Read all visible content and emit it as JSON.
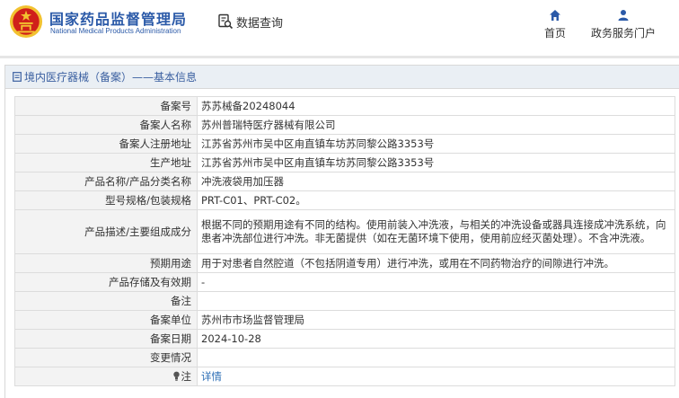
{
  "header": {
    "org_name_cn": "国家药品监督管理局",
    "org_name_en": "National Medical Products Administration",
    "query_label": "数据查询",
    "nav": [
      {
        "label": "首页",
        "icon": "home-icon"
      },
      {
        "label": "政务服务门户",
        "icon": "user-icon"
      }
    ]
  },
  "panel": {
    "title": "境内医疗器械（备案）——基本信息"
  },
  "rows": [
    {
      "label": "备案号",
      "value": "苏苏械备20248044"
    },
    {
      "label": "备案人名称",
      "value": "苏州普瑞特医疗器械有限公司"
    },
    {
      "label": "备案人注册地址",
      "value": "江苏省苏州市吴中区甪直镇车坊苏同黎公路3353号"
    },
    {
      "label": "生产地址",
      "value": "江苏省苏州市吴中区甪直镇车坊苏同黎公路3353号"
    },
    {
      "label": "产品名称/产品分类名称",
      "value": "冲洗液袋用加压器"
    },
    {
      "label": "型号规格/包装规格",
      "value": "PRT-C01、PRT-C02。"
    },
    {
      "label": "产品描述/主要组成成分",
      "value": "根据不同的预期用途有不同的结构。使用前装入冲洗液，与相关的冲洗设备或器具连接成冲洗系统，向患者冲洗部位进行冲洗。非无菌提供（如在无菌环境下使用，使用前应经灭菌处理）。不含冲洗液。"
    },
    {
      "label": "预期用途",
      "value": "用于对患者自然腔道（不包括阴道专用）进行冲洗，或用在不同药物治疗的间隙进行冲洗。"
    },
    {
      "label": "产品存储及有效期",
      "value": "-"
    },
    {
      "label": "备注",
      "value": ""
    },
    {
      "label": "备案单位",
      "value": "苏州市市场监督管理局"
    },
    {
      "label": "备案日期",
      "value": "2024-10-28"
    },
    {
      "label": "变更情况",
      "value": ""
    }
  ],
  "note_row": {
    "label": "注",
    "link": "详情"
  },
  "colors": {
    "brand_blue": "#2b5aa8",
    "link_blue": "#2b6db5",
    "label_bg": "#f3f3f3",
    "head_bg": "#eaeff4",
    "emblem_red": "#d0201a",
    "emblem_gold": "#f2c230"
  }
}
